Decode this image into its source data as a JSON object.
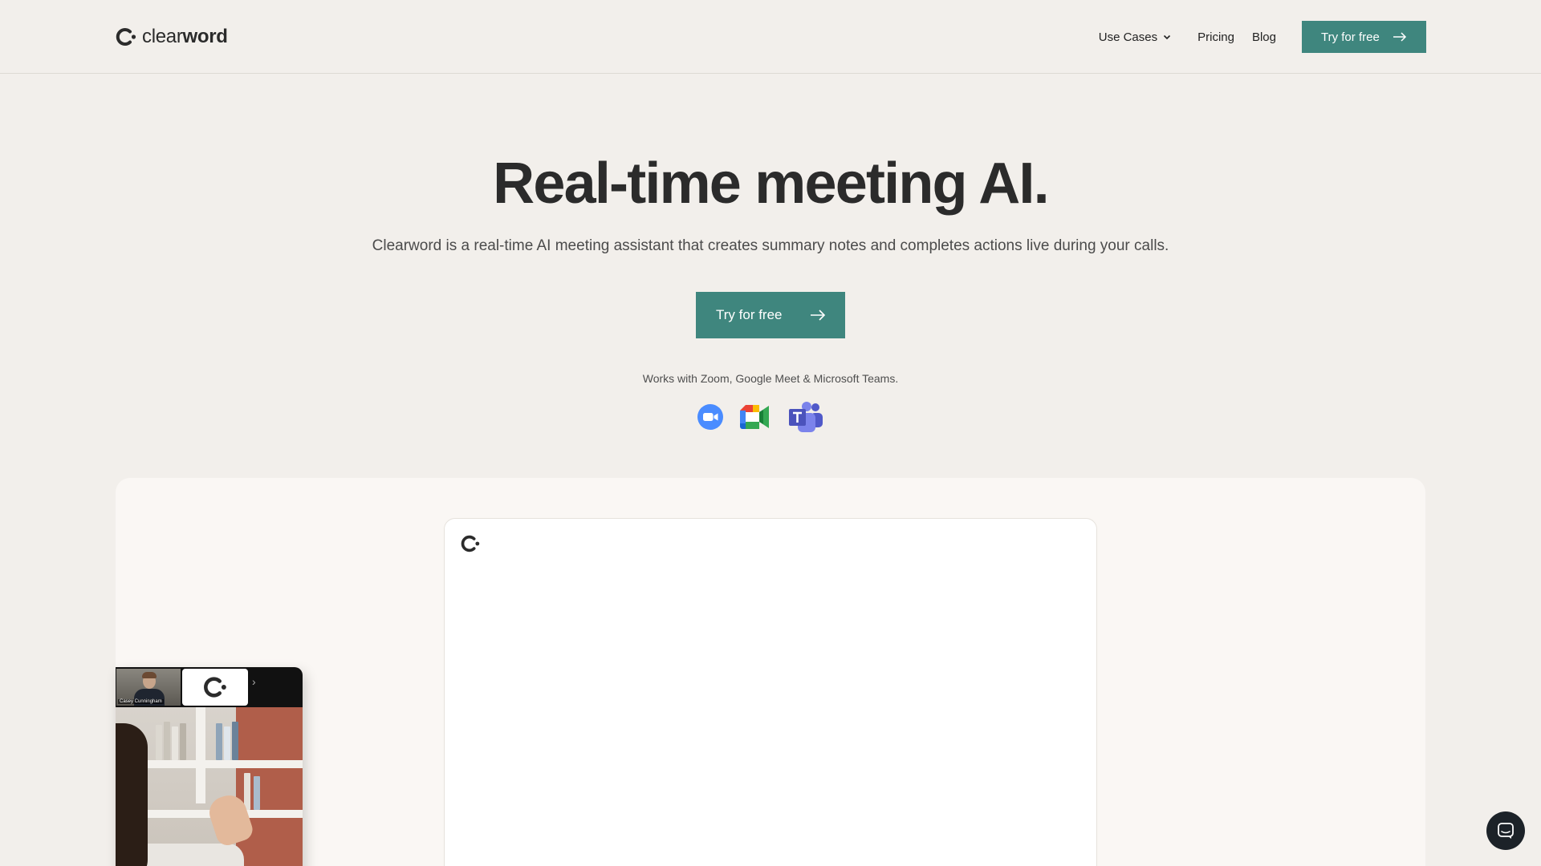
{
  "brand": {
    "name_light": "clear",
    "name_bold": "word",
    "accent_color": "#3f867e"
  },
  "nav": {
    "use_cases": "Use Cases",
    "pricing": "Pricing",
    "blog": "Blog",
    "cta": "Try for free"
  },
  "hero": {
    "title": "Real-time meeting AI.",
    "subtitle": "Clearword is a real-time AI meeting assistant that creates summary notes and completes actions live during your calls.",
    "cta": "Try for free",
    "works_with": "Works with Zoom, Google Meet & Microsoft Teams."
  },
  "integrations": [
    {
      "icon": "zoom-icon"
    },
    {
      "icon": "google-meet-icon"
    },
    {
      "icon": "microsoft-teams-icon"
    }
  ],
  "video_call": {
    "participant_name": "Casey Cunningham"
  },
  "chat": {
    "icon": "chat-icon"
  }
}
